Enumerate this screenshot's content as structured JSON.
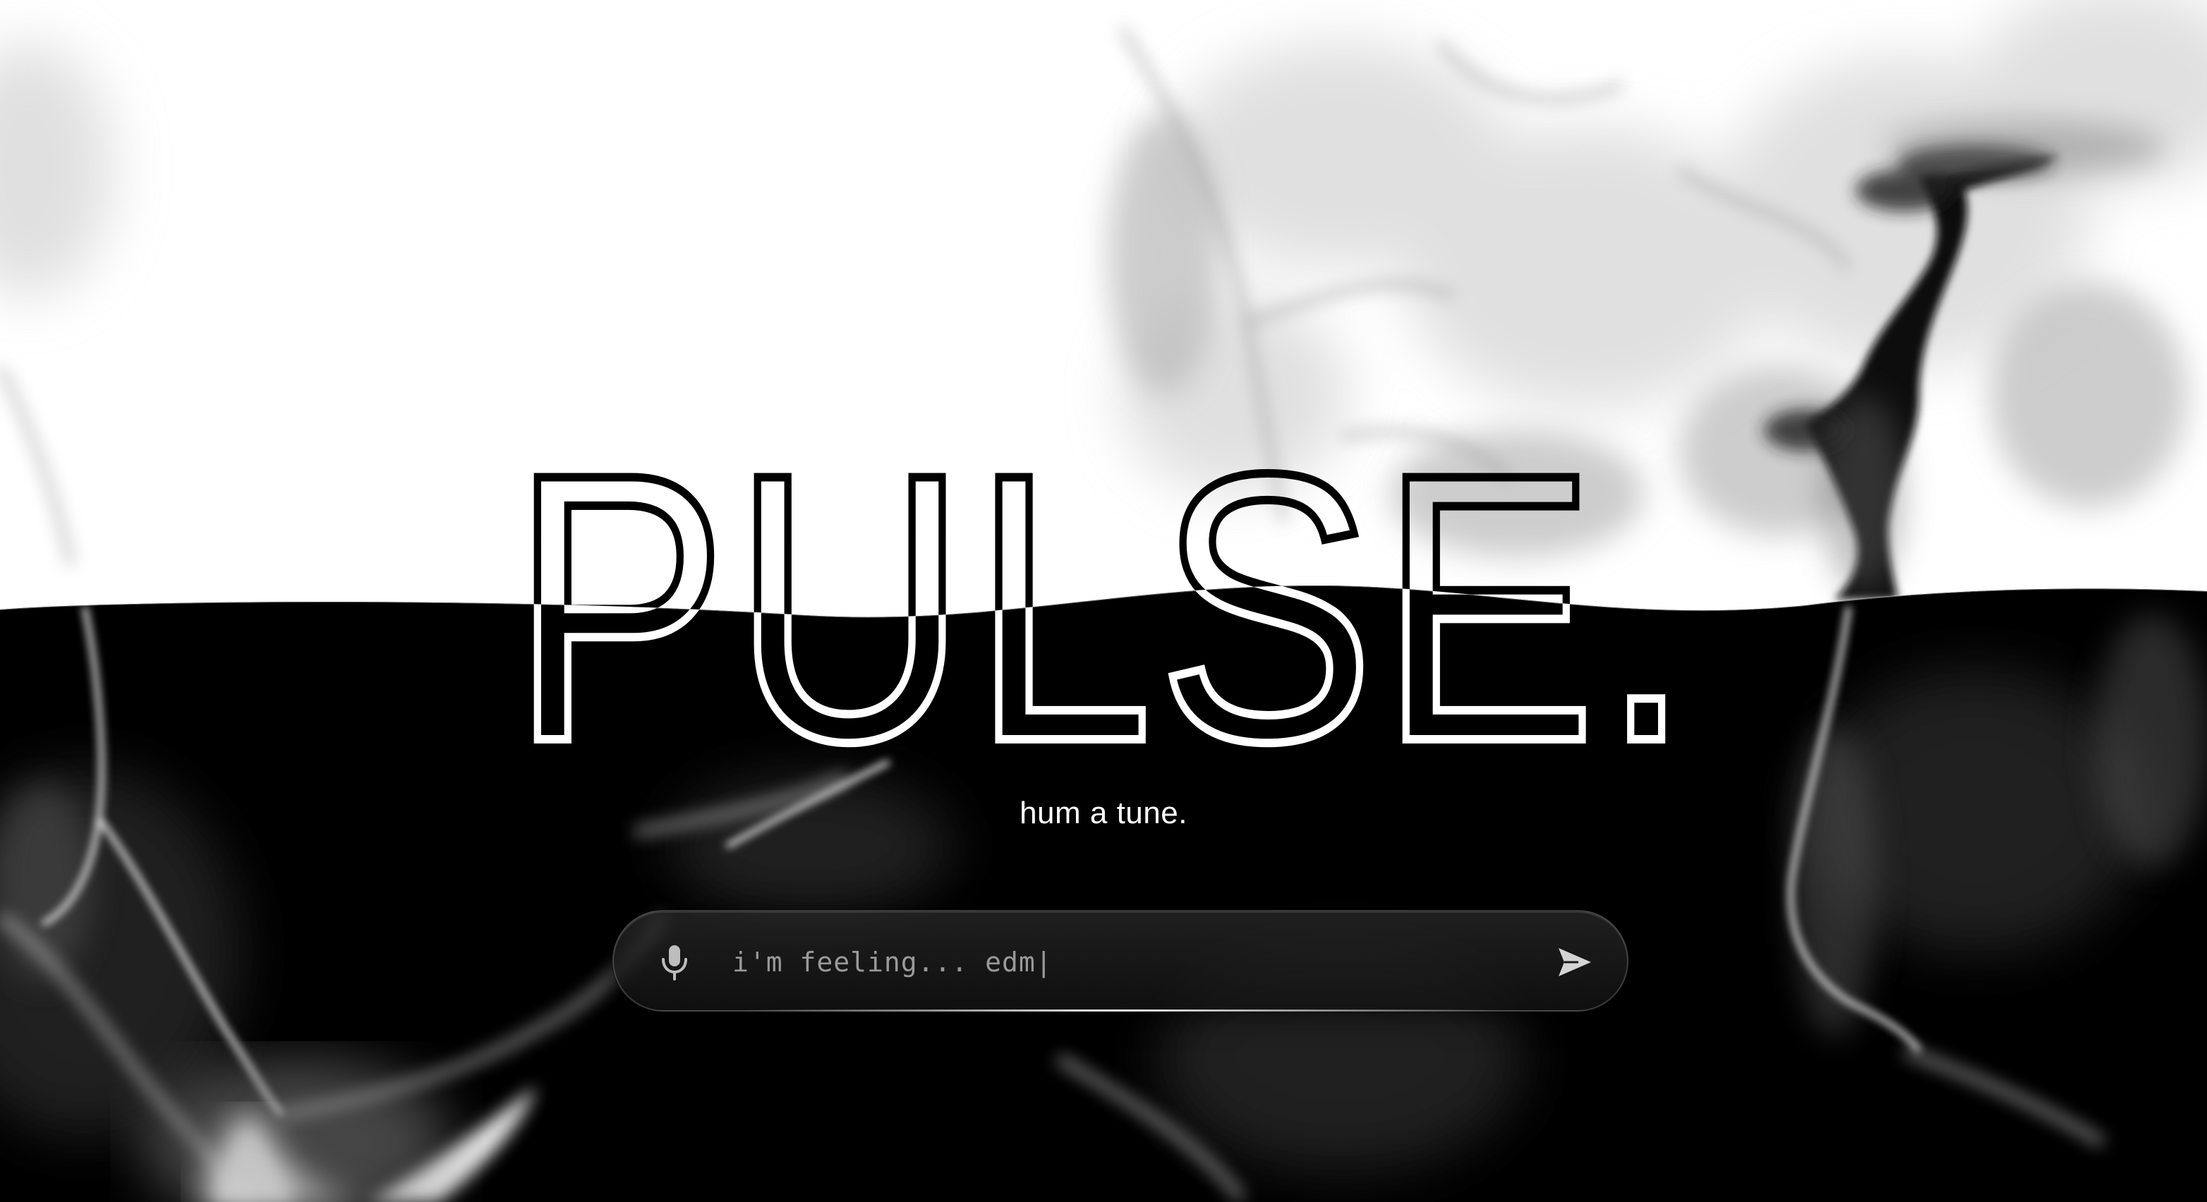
{
  "brand": {
    "title": "PULSE."
  },
  "hero": {
    "tagline": "hum a tune."
  },
  "prompt": {
    "value": "i'm feeling... edm|"
  },
  "icons": {
    "mic": "microphone-icon",
    "send": "send-arrow-icon"
  },
  "colors": {
    "light": "#ffffff",
    "dark": "#000000",
    "input_text": "#9a9a9a",
    "icon": "#bdbdbd"
  }
}
